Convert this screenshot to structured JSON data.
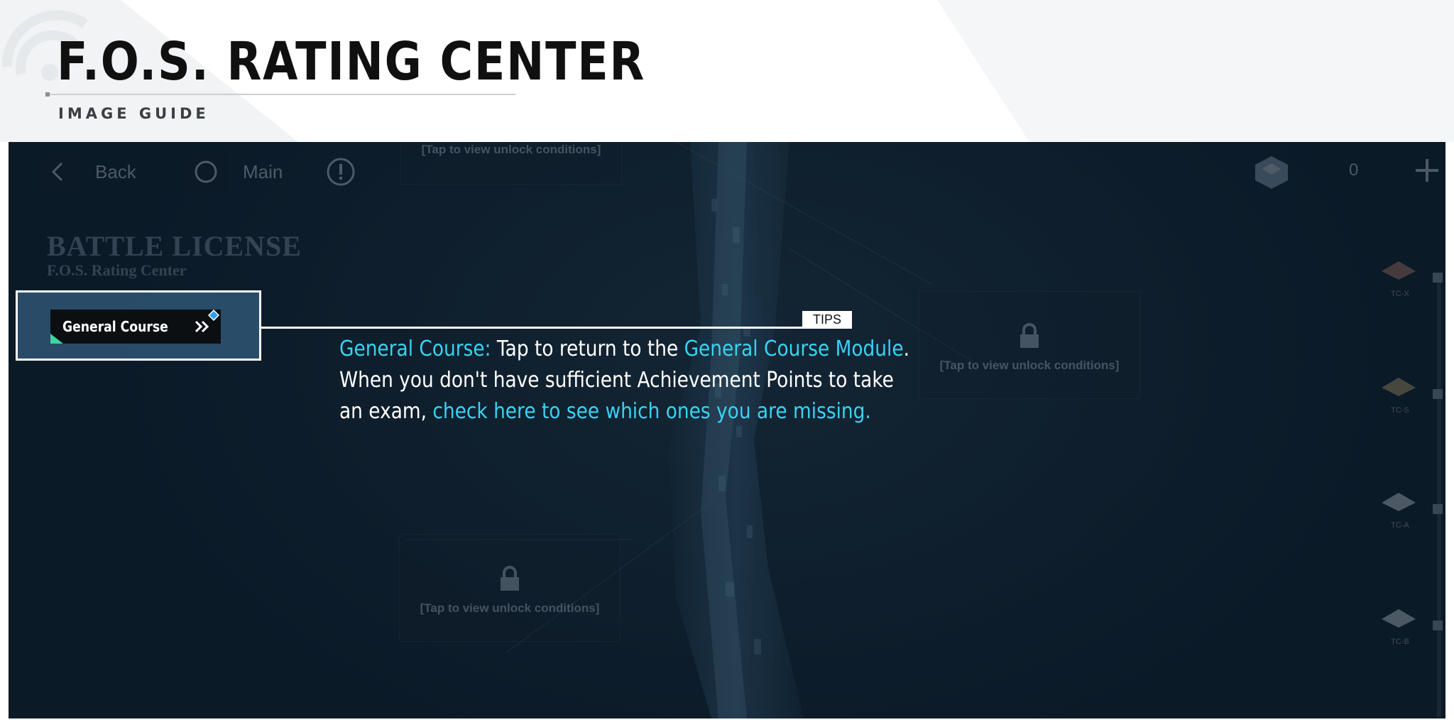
{
  "header": {
    "title": "F.O.S. RATING CENTER",
    "subtitle": "IMAGE GUIDE"
  },
  "game_ui": {
    "back_label": "Back",
    "main_label": "Main",
    "currency_value": "0",
    "battle_license_title": "BATTLE LICENSE",
    "battle_license_subtitle": "F.O.S. Rating Center",
    "lock_text": "[Tap to view unlock conditions]",
    "rail_labels": [
      "TC-X",
      "TC-S",
      "TC-A",
      "TC-B"
    ]
  },
  "highlight": {
    "button_label": "General Course",
    "tips_label": "TIPS",
    "tip": {
      "p1": "General Course:",
      "p2": " Tap to return to the ",
      "p3": "General Course Module",
      "p4": ".",
      "p5": "When you don't have sufficient Achievement Points to take",
      "p6": "an exam, ",
      "p7": "check here to see which ones you are missing."
    }
  },
  "colors": {
    "highlight_text": "#38d3f2",
    "frame": "#ffffff",
    "background": "#162a3a"
  }
}
